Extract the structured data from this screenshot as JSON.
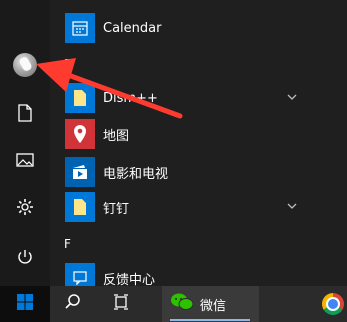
{
  "start_menu": {
    "apps": [
      {
        "name": "Calendar",
        "icon": "calendar-icon",
        "color": "#0078d7"
      },
      {
        "name": "Dism++",
        "icon": "folder-icon",
        "color": "#0078d7",
        "expandable": true
      },
      {
        "name": "地图",
        "icon": "map-pin-icon",
        "color": "#d13438"
      },
      {
        "name": "电影和电视",
        "icon": "movie-play-icon",
        "color": "#0063b1"
      },
      {
        "name": "钉钉",
        "icon": "folder-icon",
        "color": "#0078d7",
        "expandable": true
      },
      {
        "name": "反馈中心",
        "icon": "feedback-icon",
        "color": "#0078d7"
      }
    ],
    "section_letters": [
      "D",
      "F"
    ]
  },
  "left_rail": {
    "items": [
      "avatar",
      "documents-icon",
      "pictures-icon",
      "settings-gear-icon",
      "power-icon"
    ]
  },
  "taskbar": {
    "start_icon": "windows-logo-icon",
    "search_icon": "search-icon",
    "taskview_icon": "task-view-icon",
    "wechat_label": "微信",
    "wechat_color": "#2dc100",
    "accent": "#0078d7"
  },
  "annotation": {
    "arrow_color": "#ff3b30"
  }
}
